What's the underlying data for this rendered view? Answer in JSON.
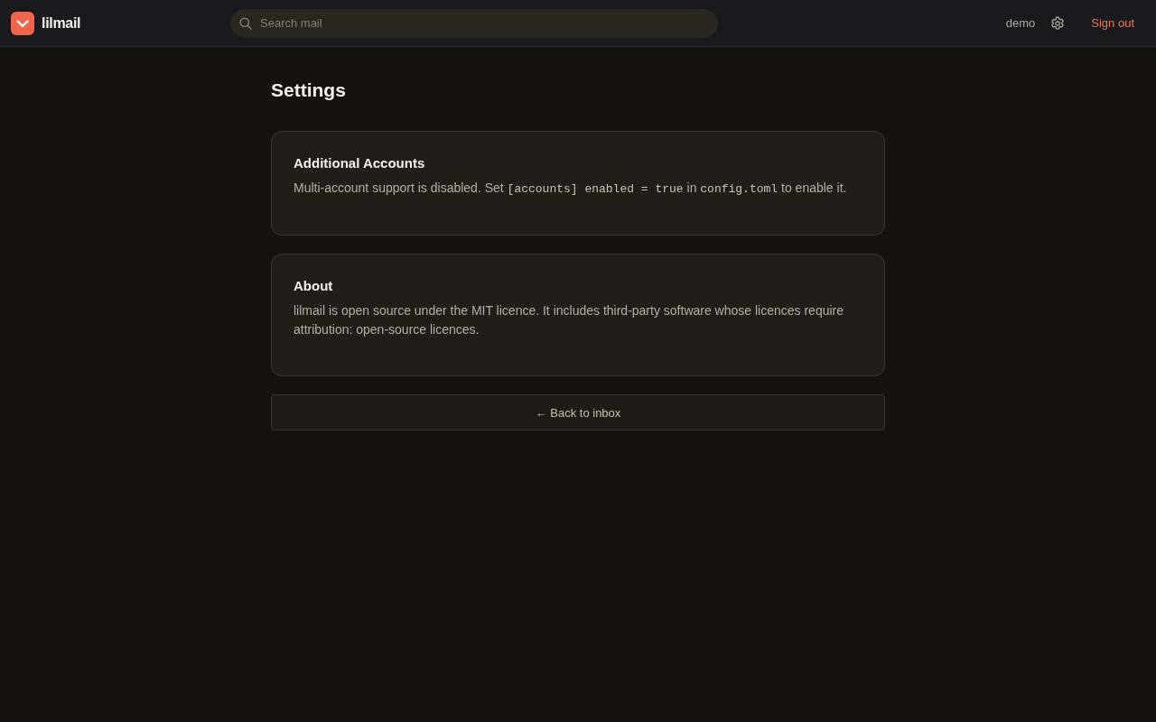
{
  "header": {
    "brand": "lilmail",
    "search": {
      "placeholder": "Search mail"
    },
    "user": "demo",
    "sign_out": "Sign out"
  },
  "page": {
    "title": "Settings"
  },
  "cards": [
    {
      "title": "Additional Accounts",
      "body": [
        {
          "kind": "text",
          "text": "Multi-account support is disabled. Set "
        },
        {
          "kind": "code",
          "text": "[accounts] enabled = true"
        },
        {
          "kind": "text",
          "text": " in "
        },
        {
          "kind": "code",
          "text": "config.toml"
        },
        {
          "kind": "text",
          "text": " to enable it."
        }
      ]
    },
    {
      "title": "About",
      "body": [
        {
          "kind": "text",
          "text": "lilmail is open source under the MIT licence. It includes third-party software whose licences require attribution: open-source licences."
        }
      ]
    }
  ],
  "back_button": "← Back to inbox"
}
